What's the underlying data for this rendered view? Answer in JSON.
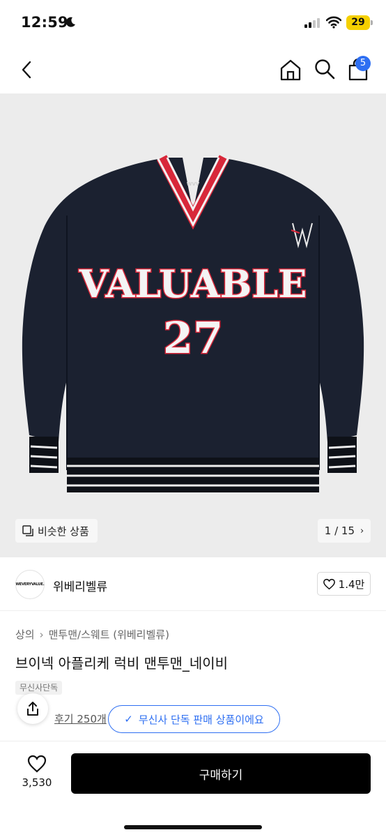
{
  "status_bar": {
    "time": "12:59",
    "battery": "29",
    "icons": [
      "moon-icon",
      "signal-icon",
      "wifi-icon",
      "battery-icon"
    ]
  },
  "nav": {
    "icons": [
      "back-icon",
      "home-icon",
      "search-icon",
      "cart-icon"
    ],
    "cart_count": "5"
  },
  "gallery": {
    "image_text": "VALUABLE",
    "image_number": "27",
    "image_tag": "WVV",
    "similar_label": "비슷한 상품",
    "page_counter": "1 / 15",
    "page_chevron": "›"
  },
  "brand": {
    "logo_text": "WEVERYVALUE.",
    "name": "위베리벨류",
    "like_count": "1.4만"
  },
  "product": {
    "breadcrumb": [
      "상의",
      "맨투맨/스웨트 (위베리벨류)"
    ],
    "breadcrumb_sep": "›",
    "title": "브이넥 아플리케 럭비 맨투맨_네이비",
    "exclusive_tag": "무신사단독",
    "review_text": "후기 250개",
    "tooltip_text": "무신사 단독 판매 상품이에요",
    "tooltip_check": "✓"
  },
  "bottom_bar": {
    "wish_count": "3,530",
    "buy_label": "구매하기"
  },
  "colors": {
    "accent": "#2e6ff2",
    "battery": "#f5d000",
    "sweater": "#1b2130",
    "stripe_red": "#d8283a",
    "buy_button": "#000000"
  }
}
